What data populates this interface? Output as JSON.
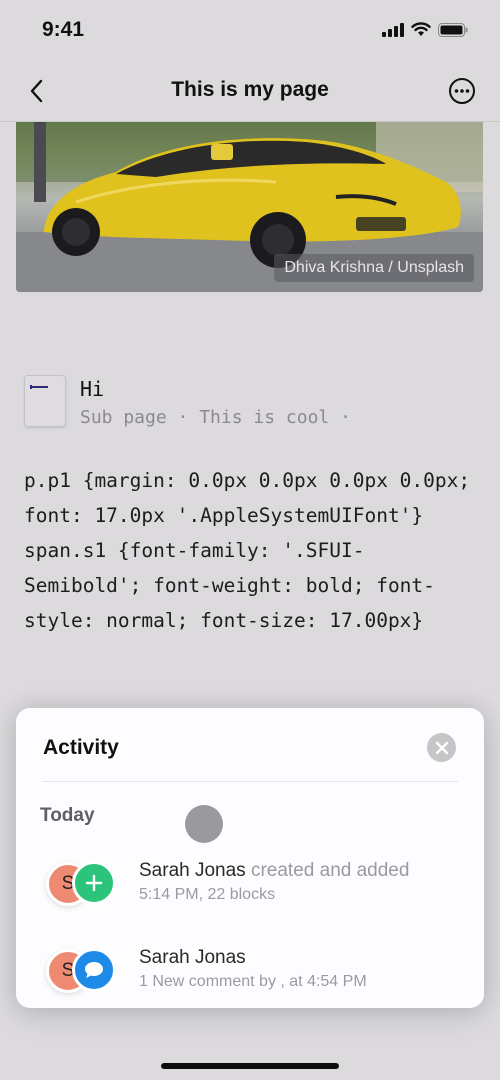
{
  "status_bar": {
    "time": "9:41",
    "icons": [
      "cellular-signal-icon",
      "wifi-icon",
      "battery-icon"
    ]
  },
  "nav": {
    "title": "This is my page",
    "back_icon": "chevron-left-icon",
    "more_icon": "ellipsis-circle-icon"
  },
  "cover": {
    "image_description": "yellow sports car",
    "credit": "Dhiva Krishna / Unsplash"
  },
  "subpage": {
    "icon": "page-icon",
    "title": "Hi",
    "meta": "Sub page · This is cool ·"
  },
  "code_block": {
    "text": "p.p1 {margin: 0.0px 0.0px 0.0px 0.0px; font: 17.0px '.AppleSystemUIFont'} span.s1 {font-family: '.SFUI-Semibold'; font-weight: bold; font-style: normal; font-size: 17.00px}"
  },
  "activity_sheet": {
    "title": "Activity",
    "close_icon": "close-icon",
    "section_label": "Today",
    "items": [
      {
        "avatar_initial": "S",
        "badge_icon": "plus-icon",
        "badge_color": "#2cc47a",
        "user": "Sarah Jonas",
        "action": "created and added",
        "detail": "5:14 PM, 22 blocks"
      },
      {
        "avatar_initial": "S",
        "badge_icon": "comment-icon",
        "badge_color": "#1d8ae8",
        "user": "Sarah Jonas",
        "action": "",
        "detail": "1 New comment by , at 4:54 PM"
      }
    ]
  },
  "colors": {
    "background": "#dcdadd",
    "sheet": "#fdfcfe",
    "avatar": "#ee8a72",
    "add_badge": "#2cc47a",
    "comment_badge": "#1d8ae8"
  }
}
